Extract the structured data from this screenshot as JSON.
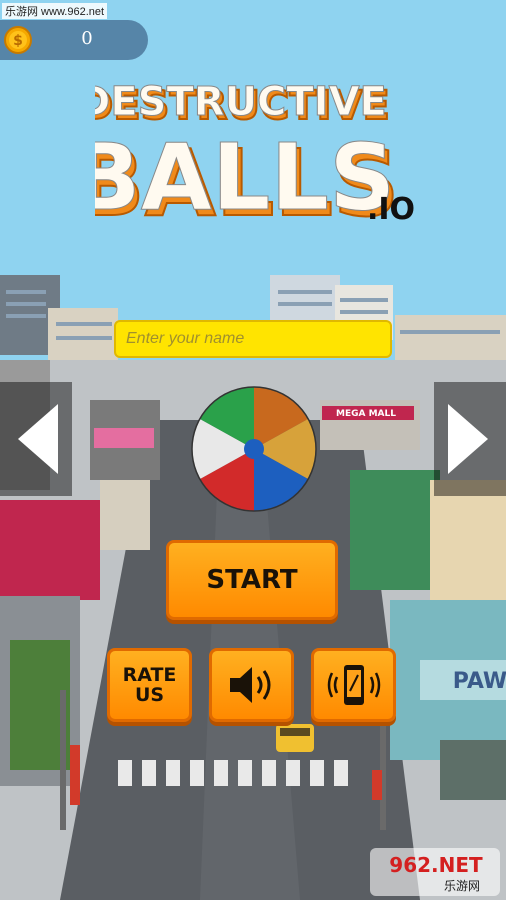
{
  "site_watermark": "乐游网 www.962.net",
  "coins": {
    "icon": "dollar-coin-icon",
    "count": "0"
  },
  "title": {
    "line1": "DESTRUCTIVE",
    "line2": "BALLS",
    "suffix": ".IO"
  },
  "name_input": {
    "placeholder": "Enter your name",
    "value": ""
  },
  "scene_signs": {
    "mall": "MEGA MALL",
    "paw": "PAW"
  },
  "buttons": {
    "start": "START",
    "rate_line1": "RATE",
    "rate_line2": "US",
    "sound_icon": "speaker-icon",
    "vibration_icon": "phone-vibrate-icon",
    "prev_icon": "arrow-left-icon",
    "next_icon": "arrow-right-icon"
  },
  "watermark_br": {
    "brand": "962.NET",
    "sub": "乐游网"
  },
  "colors": {
    "button": "#ff9a10",
    "input": "#ffe400",
    "title": "#ffffff"
  }
}
